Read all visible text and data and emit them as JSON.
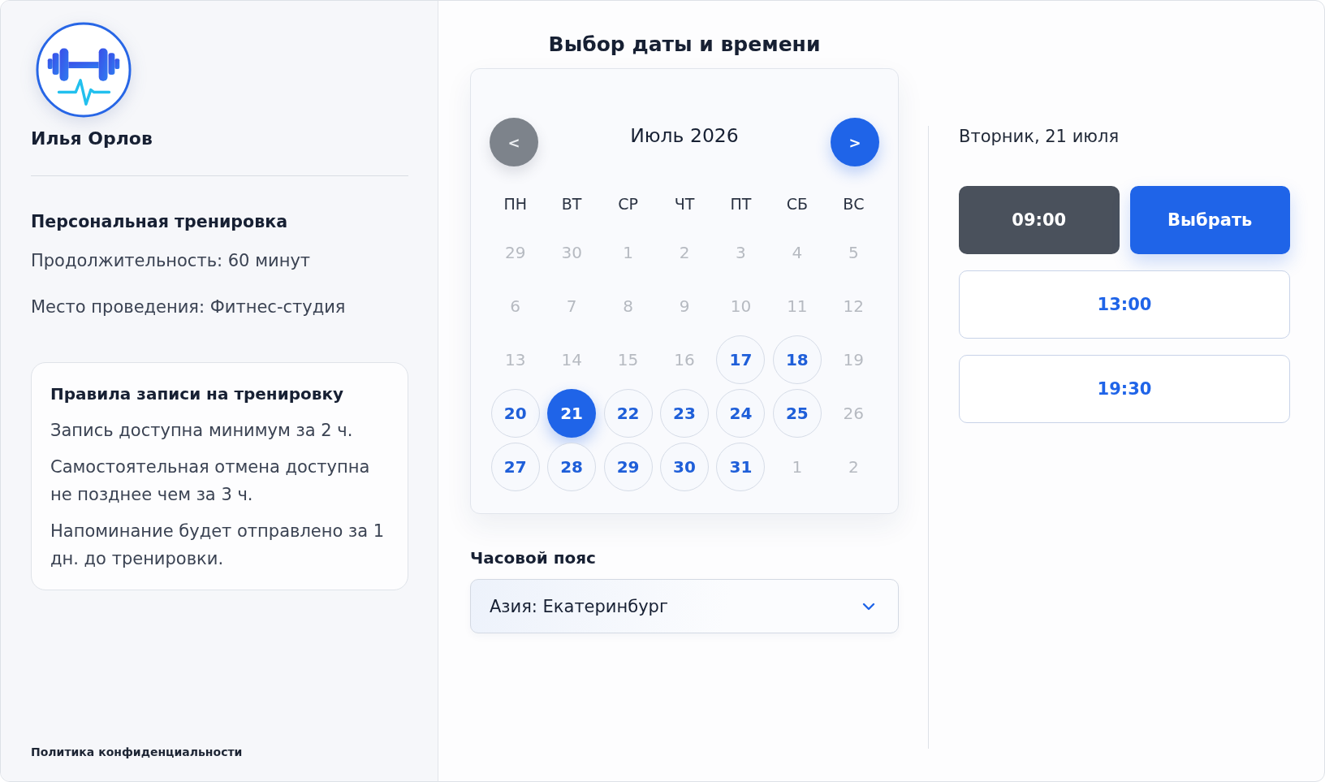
{
  "sidebar": {
    "trainer_name": "Илья Орлов",
    "service_title": "Персональная тренировка",
    "details": [
      "Продолжительность: 60 минут",
      "Место проведения: Фитнес-студия"
    ],
    "rules": {
      "title": "Правила записи на тренировку",
      "items": [
        "Запись доступна минимум за 2 ч.",
        "Самостоятельная отмена доступна не позднее чем за 3 ч.",
        "Напоминание будет отправлено за 1 дн. до тренировки."
      ]
    },
    "footer_link": "Политика конфиденциальности"
  },
  "scheduler": {
    "title": "Выбор даты и времени",
    "calendar": {
      "prev_button": {
        "label": "<",
        "disabled": true
      },
      "month": "Июль 2026",
      "next_button": {
        "label": ">",
        "disabled": false
      },
      "weekdays": [
        "ПН",
        "ВТ",
        "СР",
        "ЧТ",
        "ПТ",
        "СБ",
        "ВС"
      ],
      "days": [
        {
          "label": "29",
          "available": false,
          "selected": false
        },
        {
          "label": "30",
          "available": false,
          "selected": false
        },
        {
          "label": "1",
          "available": false,
          "selected": false
        },
        {
          "label": "2",
          "available": false,
          "selected": false
        },
        {
          "label": "3",
          "available": false,
          "selected": false
        },
        {
          "label": "4",
          "available": false,
          "selected": false
        },
        {
          "label": "5",
          "available": false,
          "selected": false
        },
        {
          "label": "6",
          "available": false,
          "selected": false
        },
        {
          "label": "7",
          "available": false,
          "selected": false
        },
        {
          "label": "8",
          "available": false,
          "selected": false
        },
        {
          "label": "9",
          "available": false,
          "selected": false
        },
        {
          "label": "10",
          "available": false,
          "selected": false
        },
        {
          "label": "11",
          "available": false,
          "selected": false
        },
        {
          "label": "12",
          "available": false,
          "selected": false
        },
        {
          "label": "13",
          "available": false,
          "selected": false
        },
        {
          "label": "14",
          "available": false,
          "selected": false
        },
        {
          "label": "15",
          "available": false,
          "selected": false
        },
        {
          "label": "16",
          "available": false,
          "selected": false
        },
        {
          "label": "17",
          "available": true,
          "selected": false
        },
        {
          "label": "18",
          "available": true,
          "selected": false
        },
        {
          "label": "19",
          "available": false,
          "selected": false
        },
        {
          "label": "20",
          "available": true,
          "selected": false
        },
        {
          "label": "21",
          "available": true,
          "selected": true
        },
        {
          "label": "22",
          "available": true,
          "selected": false
        },
        {
          "label": "23",
          "available": true,
          "selected": false
        },
        {
          "label": "24",
          "available": true,
          "selected": false
        },
        {
          "label": "25",
          "available": true,
          "selected": false
        },
        {
          "label": "26",
          "available": false,
          "selected": false
        },
        {
          "label": "27",
          "available": true,
          "selected": false
        },
        {
          "label": "28",
          "available": true,
          "selected": false
        },
        {
          "label": "29",
          "available": true,
          "selected": false
        },
        {
          "label": "30",
          "available": true,
          "selected": false
        },
        {
          "label": "31",
          "available": true,
          "selected": false
        },
        {
          "label": "1",
          "available": false,
          "selected": false
        },
        {
          "label": "2",
          "available": false,
          "selected": false
        }
      ]
    },
    "timezone": {
      "label": "Часовой пояс",
      "value": "Азия: Екатеринбург"
    }
  },
  "times": {
    "date_heading": "Вторник, 21 июля",
    "slots": [
      {
        "time": "09:00",
        "selected": true
      },
      {
        "time": "13:00",
        "selected": false
      },
      {
        "time": "19:30",
        "selected": false
      }
    ],
    "confirm_button": "Выбрать"
  }
}
